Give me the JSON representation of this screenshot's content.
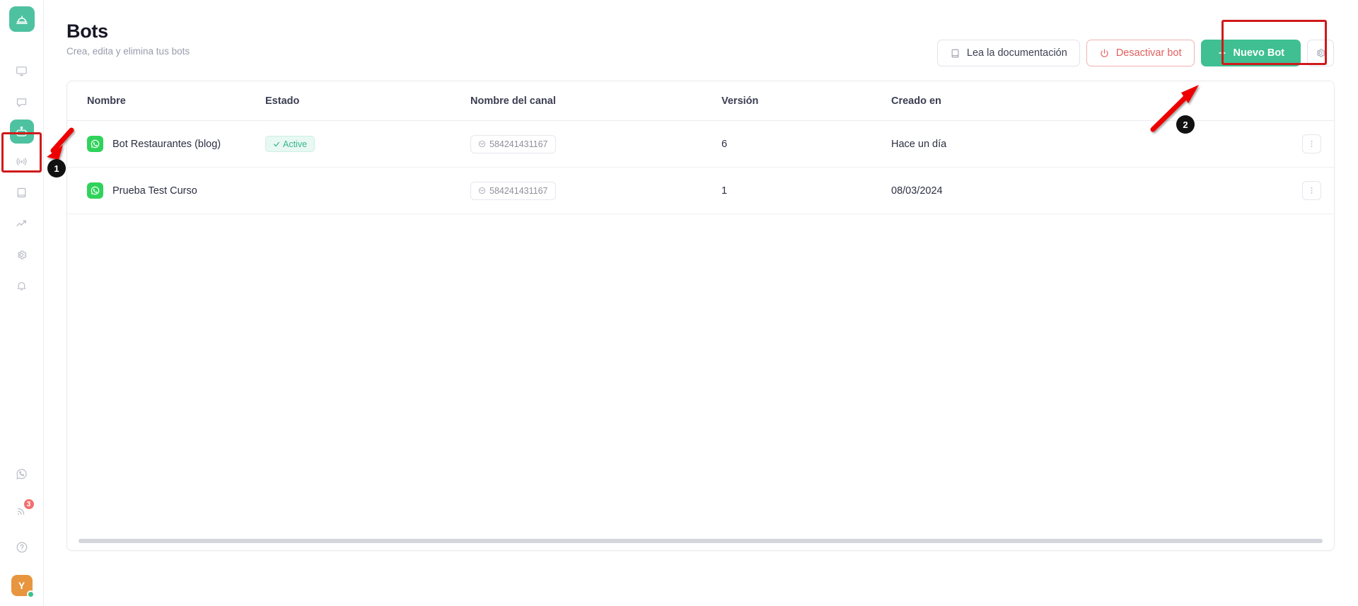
{
  "sidebar": {
    "logo": {
      "icon": "service-bell-icon"
    },
    "items": [
      {
        "name": "monitor-icon",
        "label": "Monitor"
      },
      {
        "name": "chat-icon",
        "label": "Chats"
      },
      {
        "name": "robot-icon",
        "label": "Bots",
        "active": true
      },
      {
        "name": "broadcast-icon",
        "label": "Difusiones"
      },
      {
        "name": "book-icon",
        "label": "Base de conocimiento"
      },
      {
        "name": "analytics-icon",
        "label": "Estadísticas"
      },
      {
        "name": "gear-icon",
        "label": "Configuración"
      },
      {
        "name": "bell-icon",
        "label": "Notificaciones"
      }
    ],
    "bottom_items": [
      {
        "name": "whatsapp-icon",
        "label": "WhatsApp"
      },
      {
        "name": "rss-icon",
        "label": "Novedades",
        "badge": "3"
      },
      {
        "name": "help-icon",
        "label": "Ayuda"
      }
    ],
    "avatar": {
      "initial": "Y",
      "status": "online"
    }
  },
  "header": {
    "title": "Bots",
    "subtitle": "Crea, edita y elimina tus bots",
    "actions": {
      "docs_label": "Lea la documentación",
      "docs_icon": "book-icon",
      "deactivate_label": "Desactivar bot",
      "deactivate_icon": "power-icon",
      "new_bot_label": "Nuevo Bot",
      "new_bot_icon": "plus-icon",
      "settings_icon": "gear-icon"
    }
  },
  "table": {
    "columns": [
      "Nombre",
      "Estado",
      "Nombre del canal",
      "Versión",
      "Creado en",
      ""
    ],
    "rows": [
      {
        "channel_icon": "whatsapp-icon",
        "name": "Bot Restaurantes (blog)",
        "status": "Active",
        "status_icon": "check-icon",
        "channel_name": "584241431167",
        "channel_name_icon": "inbox-icon",
        "version": "6",
        "created": "Hace un día",
        "menu_icon": "kebab-menu-icon"
      },
      {
        "channel_icon": "whatsapp-icon",
        "name": "Prueba Test Curso",
        "status": "",
        "status_icon": "",
        "channel_name": "584241431167",
        "channel_name_icon": "inbox-icon",
        "version": "1",
        "created": "08/03/2024",
        "menu_icon": "kebab-menu-icon"
      }
    ]
  },
  "annotations": {
    "marker_1": "1",
    "marker_2": "2",
    "highlight_color": "#cf1a1a"
  },
  "colors": {
    "accent_green": "#3fbf92",
    "danger_red": "#e35d5d",
    "whatsapp_green": "#2fd35b",
    "avatar_orange": "#e8953f",
    "badge_red": "#f2706e"
  }
}
